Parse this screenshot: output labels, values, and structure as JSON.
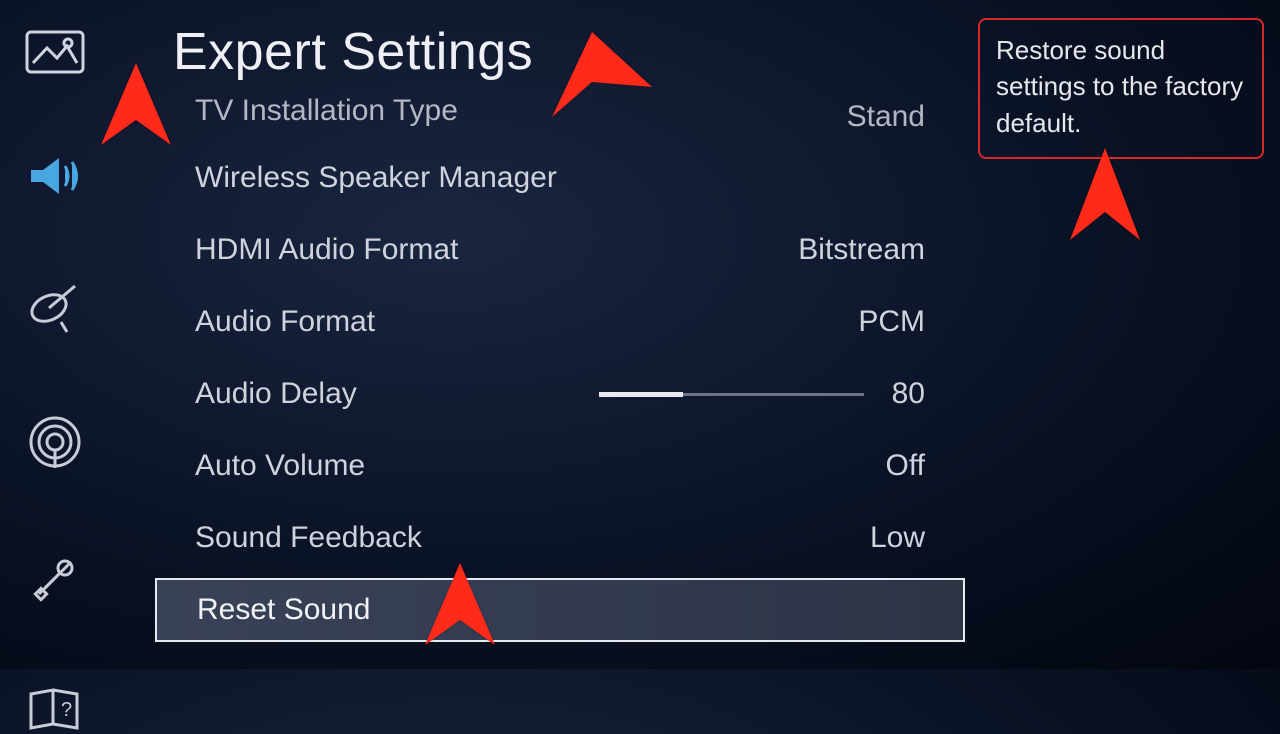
{
  "colors": {
    "accent": "#4aa6e0",
    "arrow": "#ff2a1a",
    "help_border": "#d22a2a"
  },
  "page_title": "Expert Settings",
  "sidebar": {
    "items": [
      {
        "name": "picture-icon"
      },
      {
        "name": "sound-icon",
        "active": true
      },
      {
        "name": "broadcast-icon"
      },
      {
        "name": "network-icon"
      },
      {
        "name": "tools-icon"
      },
      {
        "name": "help-icon"
      }
    ]
  },
  "menu": {
    "items": [
      {
        "label": "TV Installation Type",
        "value": "Stand"
      },
      {
        "label": "Wireless Speaker Manager",
        "value": ""
      },
      {
        "label": "HDMI Audio Format",
        "value": "Bitstream"
      },
      {
        "label": "Audio Format",
        "value": "PCM"
      },
      {
        "label": "Audio Delay",
        "slider": {
          "value": 80,
          "max": 250
        }
      },
      {
        "label": "Auto Volume",
        "value": "Off"
      },
      {
        "label": "Sound Feedback",
        "value": "Low"
      },
      {
        "label": "Reset Sound",
        "value": "",
        "selected": true
      }
    ]
  },
  "help_text": "Restore sound settings to the factory default."
}
